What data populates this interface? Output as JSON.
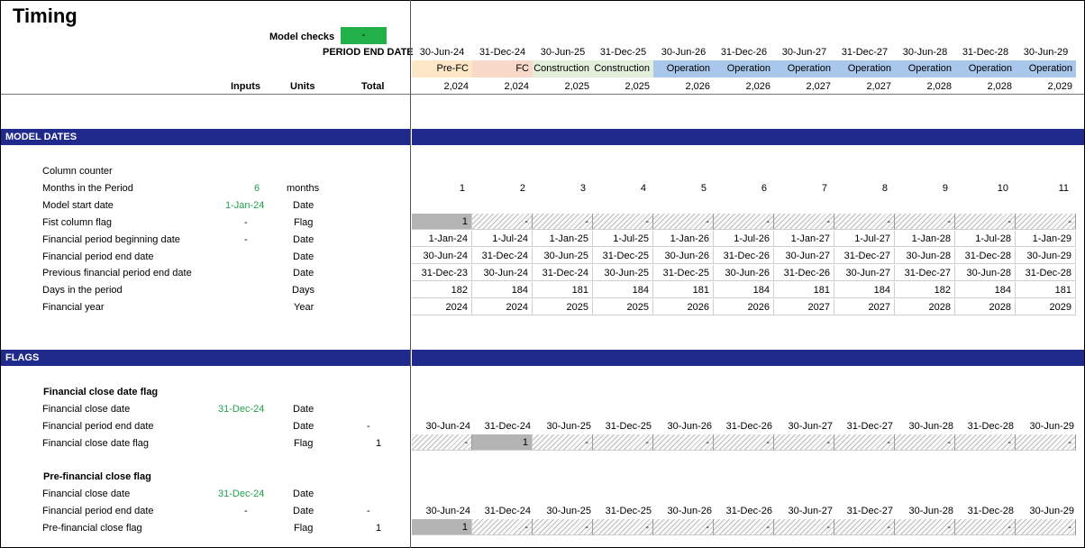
{
  "title": "Timing",
  "model_checks": {
    "label": "Model checks",
    "value": "-",
    "color": "#22b04b"
  },
  "period_end_label": "PERIOD END DATE",
  "period_ends": [
    "30-Jun-24",
    "31-Dec-24",
    "30-Jun-25",
    "31-Dec-25",
    "30-Jun-26",
    "31-Dec-26",
    "30-Jun-27",
    "31-Dec-27",
    "30-Jun-28",
    "31-Dec-28",
    "30-Jun-29"
  ],
  "phases": [
    "Pre-FC",
    "FC",
    "Construction",
    "Construction",
    "Operation",
    "Operation",
    "Operation",
    "Operation",
    "Operation",
    "Operation",
    "Operation"
  ],
  "years_row": [
    "2,024",
    "2,024",
    "2,025",
    "2,025",
    "2,026",
    "2,026",
    "2,027",
    "2,027",
    "2,028",
    "2,028",
    "2,029"
  ],
  "headers": {
    "inputs": "Inputs",
    "units": "Units",
    "total": "Total"
  },
  "model_dates": {
    "section_title": "MODEL DATES",
    "column_counter": "Column counter",
    "months_label": "Months in the Period",
    "months_input": "6",
    "months_unit": "months",
    "counter_values": [
      "1",
      "2",
      "3",
      "4",
      "5",
      "6",
      "7",
      "8",
      "9",
      "10",
      "11"
    ],
    "start_label": "Model start date",
    "start_input": "1-Jan-24",
    "start_unit": "Date",
    "first_flag_label": "Fist column flag",
    "first_flag_input": "-",
    "first_flag_unit": "Flag",
    "first_flag_values": [
      "1",
      "-",
      "-",
      "-",
      "-",
      "-",
      "-",
      "-",
      "-",
      "-",
      "-"
    ],
    "begin_label": "Financial period beginning date",
    "begin_input": "-",
    "begin_unit": "Date",
    "begin_values": [
      "1-Jan-24",
      "1-Jul-24",
      "1-Jan-25",
      "1-Jul-25",
      "1-Jan-26",
      "1-Jul-26",
      "1-Jan-27",
      "1-Jul-27",
      "1-Jan-28",
      "1-Jul-28",
      "1-Jan-29"
    ],
    "end_label": "Financial period end date",
    "end_unit": "Date",
    "end_values": [
      "30-Jun-24",
      "31-Dec-24",
      "30-Jun-25",
      "31-Dec-25",
      "30-Jun-26",
      "31-Dec-26",
      "30-Jun-27",
      "31-Dec-27",
      "30-Jun-28",
      "31-Dec-28",
      "30-Jun-29"
    ],
    "prev_label": "Previous financial period end date",
    "prev_unit": "Date",
    "prev_values": [
      "31-Dec-23",
      "30-Jun-24",
      "31-Dec-24",
      "30-Jun-25",
      "31-Dec-25",
      "30-Jun-26",
      "31-Dec-26",
      "30-Jun-27",
      "31-Dec-27",
      "30-Jun-28",
      "31-Dec-28"
    ],
    "days_label": "Days in the period",
    "days_unit": "Days",
    "days_values": [
      "182",
      "184",
      "181",
      "184",
      "181",
      "184",
      "181",
      "184",
      "182",
      "184",
      "181"
    ],
    "fy_label": "Financial year",
    "fy_unit": "Year",
    "fy_values": [
      "2024",
      "2024",
      "2025",
      "2025",
      "2026",
      "2026",
      "2027",
      "2027",
      "2028",
      "2028",
      "2029"
    ]
  },
  "flags": {
    "section_title": "FLAGS",
    "fc_group": {
      "title": "Financial close date flag",
      "close_label": "Financial close date",
      "close_input": "31-Dec-24",
      "close_unit": "Date",
      "end_label": "Financial period end date",
      "end_unit": "Date",
      "end_total": "-",
      "end_values": [
        "30-Jun-24",
        "31-Dec-24",
        "30-Jun-25",
        "31-Dec-25",
        "30-Jun-26",
        "31-Dec-26",
        "30-Jun-27",
        "31-Dec-27",
        "30-Jun-28",
        "31-Dec-28",
        "30-Jun-29"
      ],
      "flag_label": "Financial close date flag",
      "flag_unit": "Flag",
      "flag_total": "1",
      "flag_values": [
        "-",
        "1",
        "-",
        "-",
        "-",
        "-",
        "-",
        "-",
        "-",
        "-",
        "-"
      ]
    },
    "prefc_group": {
      "title": "Pre-financial close flag",
      "close_label": "Financial close date",
      "close_input": "31-Dec-24",
      "close_unit": "Date",
      "end_label": "Financial period end date",
      "end_input": "-",
      "end_unit": "Date",
      "end_total": "-",
      "end_values": [
        "30-Jun-24",
        "31-Dec-24",
        "30-Jun-25",
        "31-Dec-25",
        "30-Jun-26",
        "31-Dec-26",
        "30-Jun-27",
        "31-Dec-27",
        "30-Jun-28",
        "31-Dec-28",
        "30-Jun-29"
      ],
      "flag_label": "Pre-financial close flag",
      "flag_unit": "Flag",
      "flag_total": "1",
      "flag_values": [
        "1",
        "-",
        "-",
        "-",
        "-",
        "-",
        "-",
        "-",
        "-",
        "-",
        "-"
      ]
    }
  }
}
